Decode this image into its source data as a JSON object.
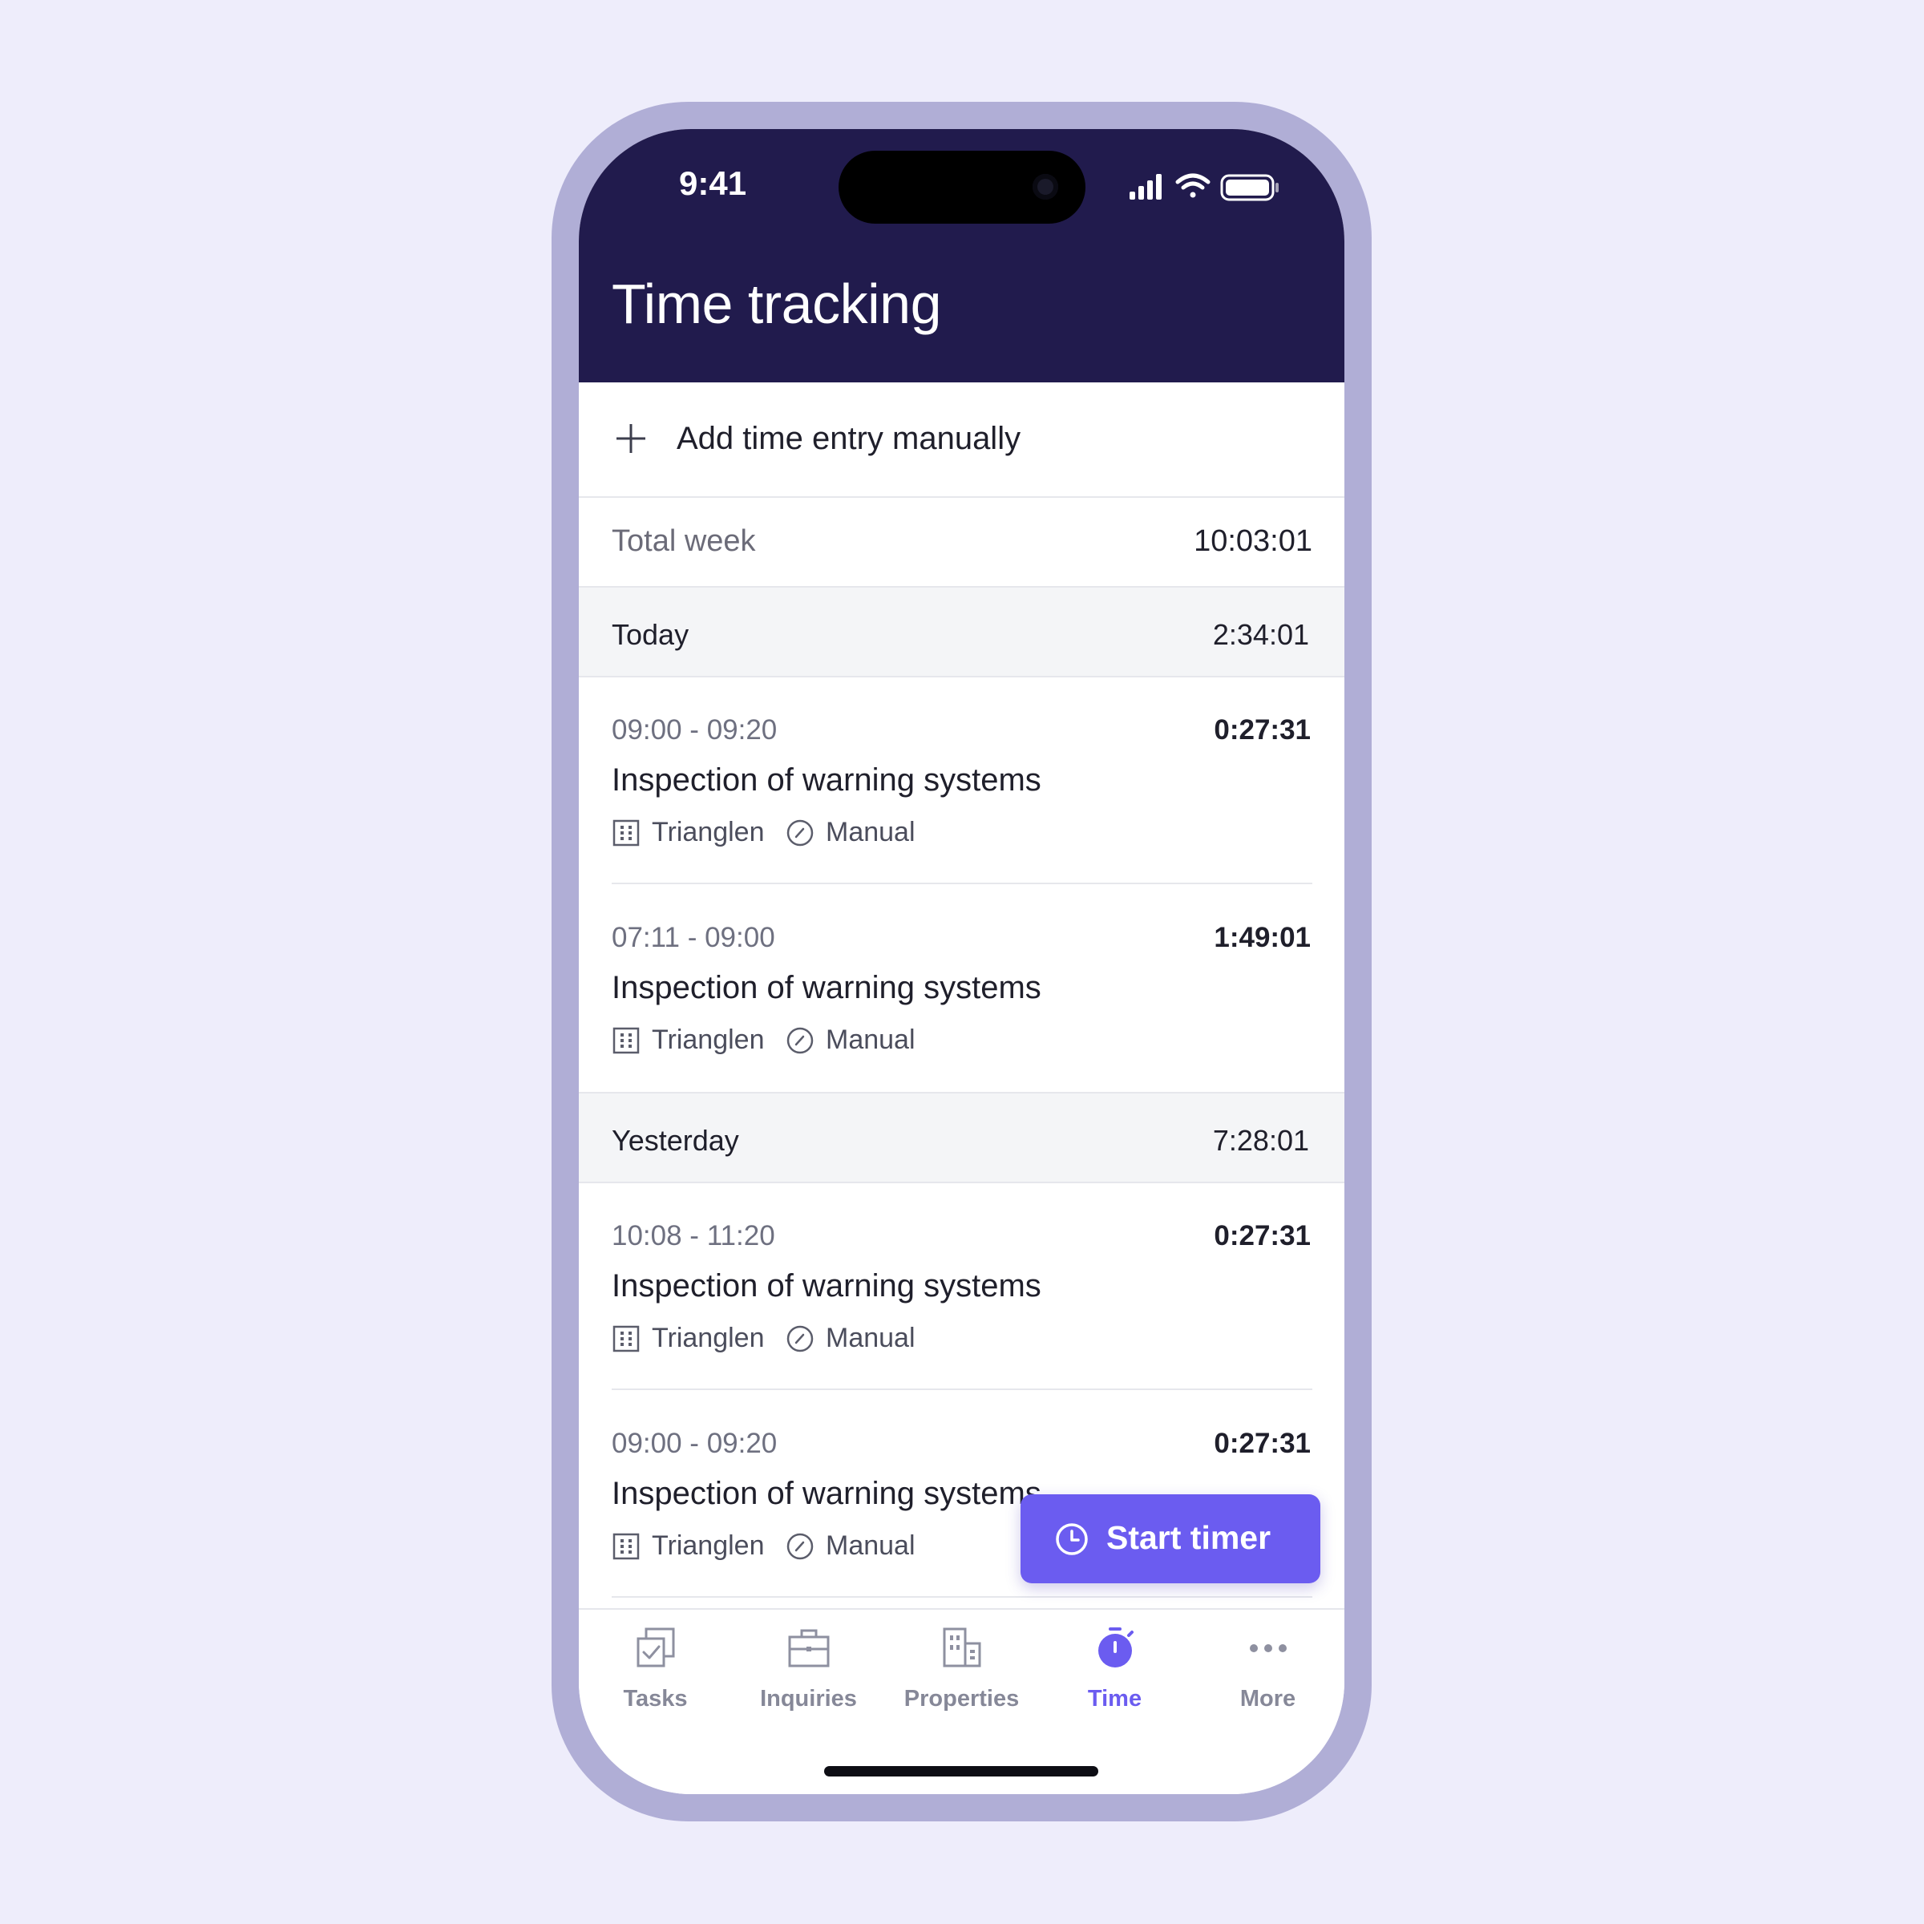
{
  "status_bar": {
    "time": "9:41"
  },
  "header": {
    "title": "Time tracking"
  },
  "add_entry": {
    "label": "Add time entry manually"
  },
  "total": {
    "label": "Total week",
    "value": "10:03:01"
  },
  "days": [
    {
      "label": "Today",
      "total": "2:34:01",
      "entries": [
        {
          "range": "09:00 - 09:20",
          "duration": "0:27:31",
          "title": "Inspection of warning systems",
          "property": "Trianglen",
          "kind": "Manual"
        },
        {
          "range": "07:11 - 09:00",
          "duration": "1:49:01",
          "title": "Inspection of warning systems",
          "property": "Trianglen",
          "kind": "Manual"
        }
      ]
    },
    {
      "label": "Yesterday",
      "total": "7:28:01",
      "entries": [
        {
          "range": "10:08 - 11:20",
          "duration": "0:27:31",
          "title": "Inspection of warning systems",
          "property": "Trianglen",
          "kind": "Manual"
        },
        {
          "range": "09:00 - 09:20",
          "duration": "0:27:31",
          "title": "Inspection of warning systems",
          "property": "Trianglen",
          "kind": "Manual"
        }
      ]
    }
  ],
  "fab": {
    "label": "Start timer",
    "icon": "clock-icon"
  },
  "tabbar": {
    "items": [
      {
        "label": "Tasks",
        "icon": "tasks-icon",
        "active": false
      },
      {
        "label": "Inquiries",
        "icon": "briefcase-icon",
        "active": false
      },
      {
        "label": "Properties",
        "icon": "building-icon",
        "active": false
      },
      {
        "label": "Time",
        "icon": "stopwatch-icon",
        "active": true
      },
      {
        "label": "More",
        "icon": "more-icon",
        "active": false
      }
    ]
  },
  "colors": {
    "header_bg": "#211b4d",
    "accent": "#6b5cf0",
    "frame": "#b0aed6",
    "page_bg": "#eeedfb"
  }
}
